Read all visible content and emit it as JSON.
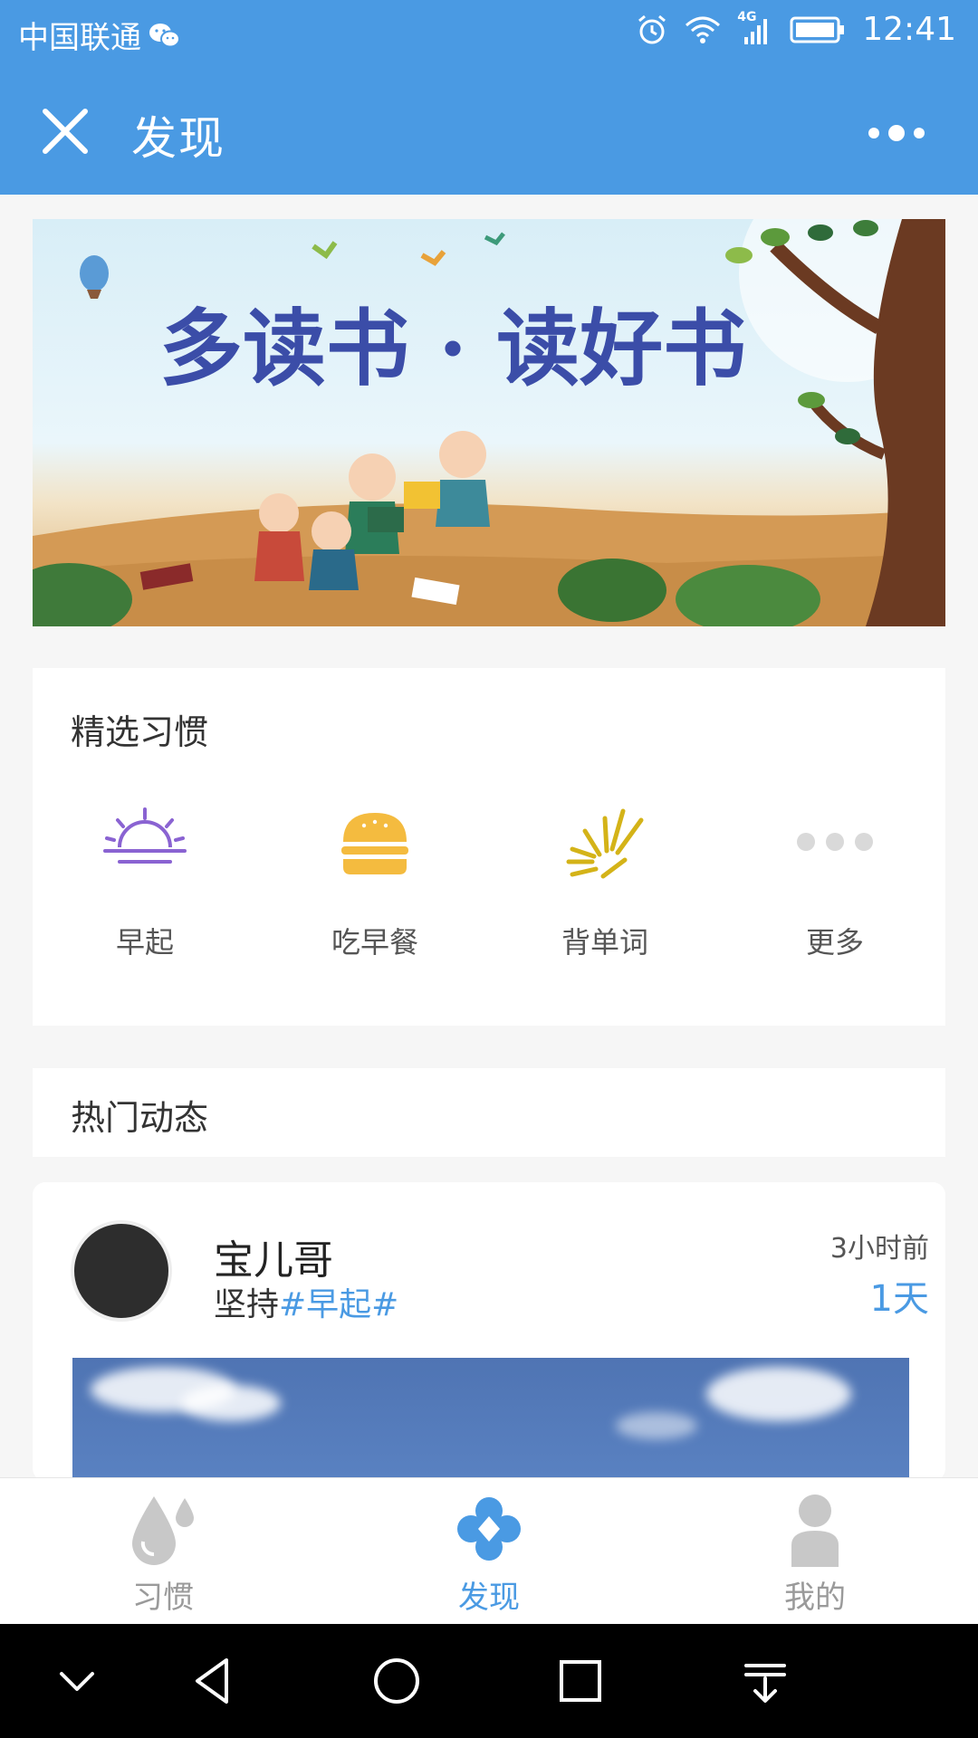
{
  "status_bar": {
    "carrier": "中国联通",
    "network": "4G",
    "time": "12:41"
  },
  "header": {
    "title": "发现",
    "close_icon": "close-icon",
    "more_icon": "more-icon"
  },
  "banner": {
    "headline": "多读书 · 读好书"
  },
  "habits_section": {
    "title": "精选习惯",
    "items": [
      {
        "label": "早起",
        "icon": "sunrise-icon",
        "color": "#8a63d2"
      },
      {
        "label": "吃早餐",
        "icon": "burger-icon",
        "color": "#f4bb3f"
      },
      {
        "label": "背单词",
        "icon": "burst-icon",
        "color": "#d4b318"
      },
      {
        "label": "更多",
        "icon": "more-dots-icon",
        "color": "#d9d9d9"
      }
    ]
  },
  "hot_section": {
    "title": "热门动态"
  },
  "post": {
    "username": "宝儿哥",
    "desc_prefix": "坚持",
    "tag": "#早起#",
    "time": "3小时前",
    "days": "1天"
  },
  "tab_bar": {
    "tabs": [
      {
        "label": "习惯",
        "icon": "drops-icon",
        "active": false
      },
      {
        "label": "发现",
        "icon": "clover-icon",
        "active": true
      },
      {
        "label": "我的",
        "icon": "person-icon",
        "active": false
      }
    ]
  },
  "colors": {
    "primary": "#4a9ae3",
    "tab_inactive": "#9a9a9a"
  }
}
